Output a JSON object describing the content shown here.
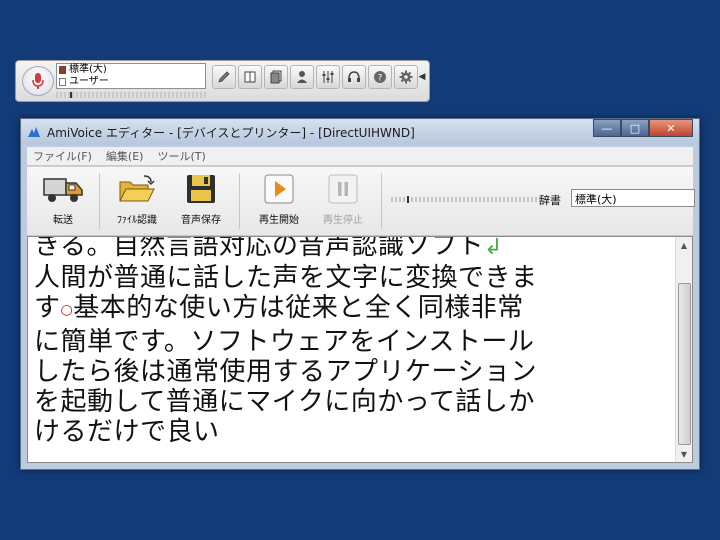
{
  "floatbar": {
    "dictionary": "標準(大)",
    "user": "ユーザー",
    "icons": [
      "pencil-icon",
      "book-icon",
      "pages-icon",
      "user-icon",
      "mixer-icon",
      "headset-icon",
      "help-icon",
      "gear-icon"
    ]
  },
  "window": {
    "title": "AmiVoice エディター - [デバイスとプリンター] - [DirectUIHWND]",
    "controls": {
      "minimize": "—",
      "maximize": "□",
      "close": "✕"
    }
  },
  "menu": [
    "ファイル(F)",
    "編集(E)",
    "ツール(T)"
  ],
  "toolbar": {
    "transfer": "転送",
    "file_recognize": "ﾌｧｲﾙ認識",
    "save_audio": "音声保存",
    "play_start": "再生開始",
    "play_stop": "再生停止",
    "dict_label": "辞書",
    "dict_value": "標準(大)"
  },
  "editor": {
    "line1": "きる。自然言語対応の音声認識ソフト",
    "return_mark": "↲",
    "line2": "人間が普通に話した声を文字に変換できま",
    "line3a": "す",
    "line3b": "基本的な使い方は従来と全く同様非常",
    "line4": "に簡単です。ソフトウェアをインストール",
    "line5": "したら後は通常使用するアプリケーション",
    "line6": "を起動して普通にマイクに向かって話しか",
    "line7": "けるだけで良い"
  },
  "colors": {
    "desktop": "#123b78",
    "accent_red": "#d11111",
    "play_orange": "#e78a1a"
  }
}
